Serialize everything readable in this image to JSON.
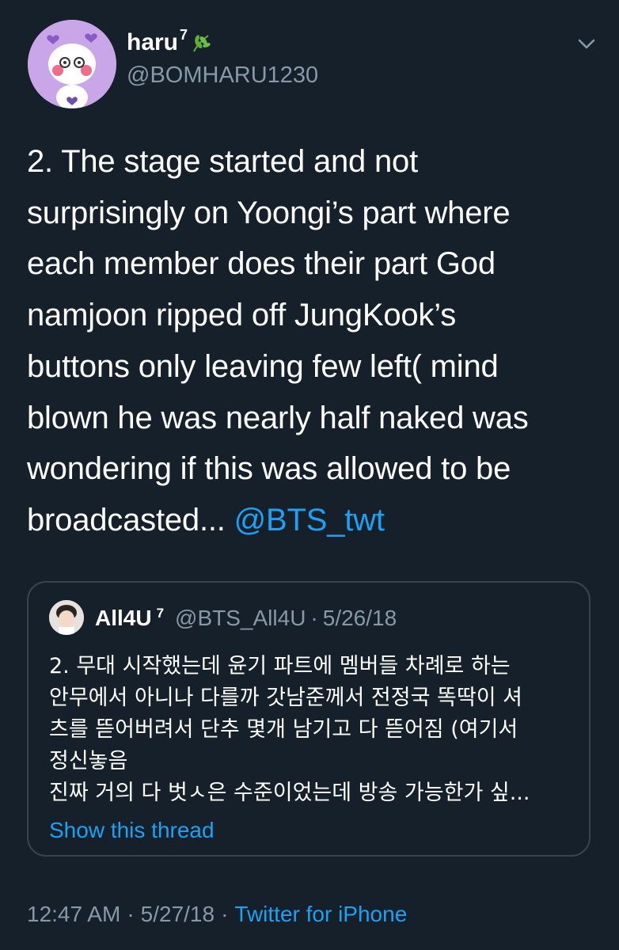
{
  "author": {
    "name": "haru",
    "name_sup": "7",
    "handle": "@BOMHARU1230",
    "leaf_color": "#5fae3b"
  },
  "tweet": {
    "lines": [
      "2. The stage started and not",
      "surprisingly on Yoongi’s part where",
      "each member does their part God",
      "namjoon ripped off JungKook’s",
      "buttons only leaving few left( mind",
      "blown he was nearly half naked was",
      "wondering if this was allowed to be",
      "broadcasted... "
    ],
    "mention": "@BTS_twt"
  },
  "quoted": {
    "name": "All4U",
    "name_sup": "7",
    "handle": "@BTS_All4U",
    "separator": "·",
    "date": "5/26/18",
    "lines": [
      "2. 무대 시작했는데 윤기 파트에 멤버들 차례로 하는",
      "안무에서 아니나 다를까 갓남준께서 전정국 똑딱이 셔",
      "츠를 뜯어버려서 단추 몇개 남기고 다 뜯어짐 (여기서",
      "정신놓음",
      "진짜 거의 다 벗ㅅ은 수준이었는데 방송 가능한가 싶..."
    ],
    "show_thread": "Show this thread"
  },
  "footer": {
    "time": "12:47 AM",
    "separator": "·",
    "date": "5/27/18",
    "source": "Twitter for iPhone"
  },
  "colors": {
    "background": "#15202b",
    "accent": "#1da1f2",
    "secondary_text": "#8899a6",
    "border": "#38444d"
  },
  "icons": {
    "menu": "chevron-down-icon",
    "badge": "leaf-icon"
  }
}
